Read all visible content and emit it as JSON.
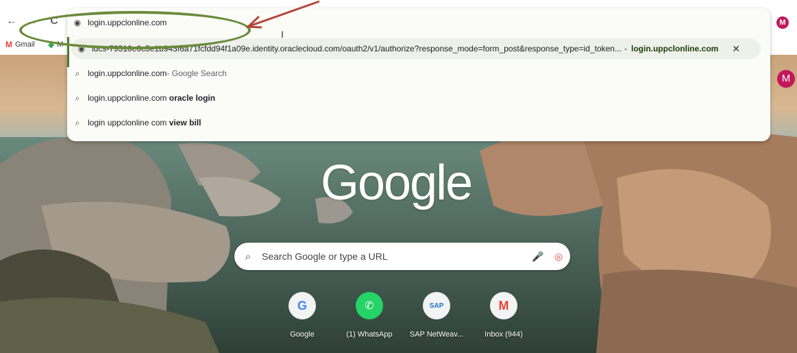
{
  "toolbar": {
    "back_glyph": "←",
    "forward_glyph": "→",
    "reload_glyph": "C",
    "profile_initial": "M"
  },
  "bookmarks": [
    {
      "label": "Gmail",
      "icon": "gmail-icon"
    },
    {
      "label": "M",
      "icon": "maps-icon"
    }
  ],
  "omnibox": {
    "input_value": "login.uppclonline.com",
    "suggestions": [
      {
        "icon": "globe-icon",
        "text": "idcs-79510e0c5e1b943f6a71fcfdd94f1a09e.identity.oraclecloud.com/oauth2/v1/authorize?response_mode=form_post&response_type=id_token...",
        "bold_mid": "com",
        "separator": "-",
        "domain": "login.uppclonline.com",
        "close": "✕"
      },
      {
        "icon": "search-icon",
        "text": "login.uppclonline.com",
        "suffix": " - Google Search"
      },
      {
        "icon": "search-icon",
        "text": "login.uppclonline.com ",
        "bold": "oracle login"
      },
      {
        "icon": "search-icon",
        "text": "login uppclonline com ",
        "bold": "view bill"
      }
    ]
  },
  "ntp": {
    "logo": "Google",
    "search_placeholder": "Search Google or type a URL",
    "profile_initial": "M",
    "shortcuts": [
      {
        "label": "Google",
        "glyph": "G",
        "color": "#4285f4"
      },
      {
        "label": "(1) WhatsApp",
        "glyph": "✆",
        "color": "#25d366"
      },
      {
        "label": "SAP NetWeav...",
        "glyph": "SAP",
        "color": "#1a73c8"
      },
      {
        "label": "Inbox (944)",
        "glyph": "M",
        "color": "#ea4335"
      }
    ]
  },
  "colors": {
    "annotation": "#6a8b3c",
    "arrow": "#b5473a",
    "profile": "#c2185b"
  }
}
